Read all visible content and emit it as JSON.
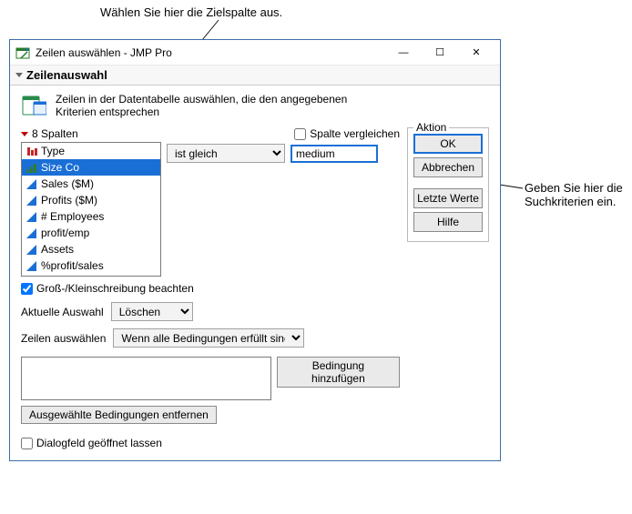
{
  "annotations": {
    "top": "Wählen Sie hier die Zielspalte aus.",
    "right": "Geben Sie hier die Suchkriterien ein."
  },
  "window": {
    "title": "Zeilen auswählen - JMP Pro"
  },
  "panel": {
    "title": "Zeilenauswahl",
    "description": "Zeilen in der Datentabelle auswählen, die den angegebenen Kriterien entsprechen"
  },
  "columns": {
    "header": "8 Spalten",
    "items": [
      {
        "label": "Type",
        "icon": "nominal-red"
      },
      {
        "label": "Size Co",
        "icon": "ordinal-green",
        "selected": true
      },
      {
        "label": "Sales ($M)",
        "icon": "continuous-blue"
      },
      {
        "label": "Profits ($M)",
        "icon": "continuous-blue"
      },
      {
        "label": "# Employees",
        "icon": "continuous-blue"
      },
      {
        "label": "profit/emp",
        "icon": "continuous-blue"
      },
      {
        "label": "Assets",
        "icon": "continuous-blue"
      },
      {
        "label": "%profit/sales",
        "icon": "continuous-blue"
      }
    ]
  },
  "criteria": {
    "compare_label": "Spalte vergleichen",
    "operator": "ist gleich",
    "value": "medium"
  },
  "options": {
    "case_label": "Groß-/Kleinschreibung beachten",
    "case_checked": true,
    "current_sel_label": "Aktuelle Auswahl",
    "current_sel_value": "Löschen",
    "rows_label": "Zeilen auswählen",
    "rows_value": "Wenn alle Bedingungen erfüllt sind",
    "add_cond": "Bedingung hinzufügen",
    "remove_cond": "Ausgewählte Bedingungen entfernen",
    "keep_open": "Dialogfeld geöffnet lassen"
  },
  "actions": {
    "legend": "Aktion",
    "ok": "OK",
    "cancel": "Abbrechen",
    "recall": "Letzte Werte",
    "help": "Hilfe"
  }
}
